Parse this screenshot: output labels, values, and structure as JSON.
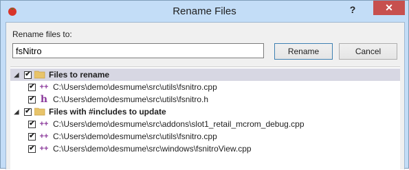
{
  "window": {
    "title": "Rename Files",
    "help_label": "?",
    "close_label": "✕"
  },
  "form": {
    "label": "Rename files to:",
    "value": "fsNitro",
    "rename_label": "Rename",
    "cancel_label": "Cancel"
  },
  "groups": [
    {
      "label": "Files to rename",
      "checked": true,
      "expanded": true,
      "files": [
        {
          "type": "cpp",
          "icon_glyph": "++",
          "path": "C:\\Users\\demo\\desmume\\src\\utils\\fsnitro.cpp",
          "checked": true
        },
        {
          "type": "h",
          "icon_glyph": "h",
          "path": "C:\\Users\\demo\\desmume\\src\\utils\\fsnitro.h",
          "checked": true
        }
      ]
    },
    {
      "label": "Files with #includes to update",
      "checked": true,
      "expanded": true,
      "files": [
        {
          "type": "cpp",
          "icon_glyph": "++",
          "path": "C:\\Users\\demo\\desmume\\src\\addons\\slot1_retail_mcrom_debug.cpp",
          "checked": true
        },
        {
          "type": "cpp",
          "icon_glyph": "++",
          "path": "C:\\Users\\demo\\desmume\\src\\utils\\fsnitro.cpp",
          "checked": true
        },
        {
          "type": "cpp",
          "icon_glyph": "++",
          "path": "C:\\Users\\demo\\desmume\\src\\windows\\fsnitroView.cpp",
          "checked": true
        }
      ]
    }
  ],
  "colors": {
    "accent": "#c7504e",
    "selection": "#d7d7e3",
    "titlebar": "#c3ddf7"
  }
}
